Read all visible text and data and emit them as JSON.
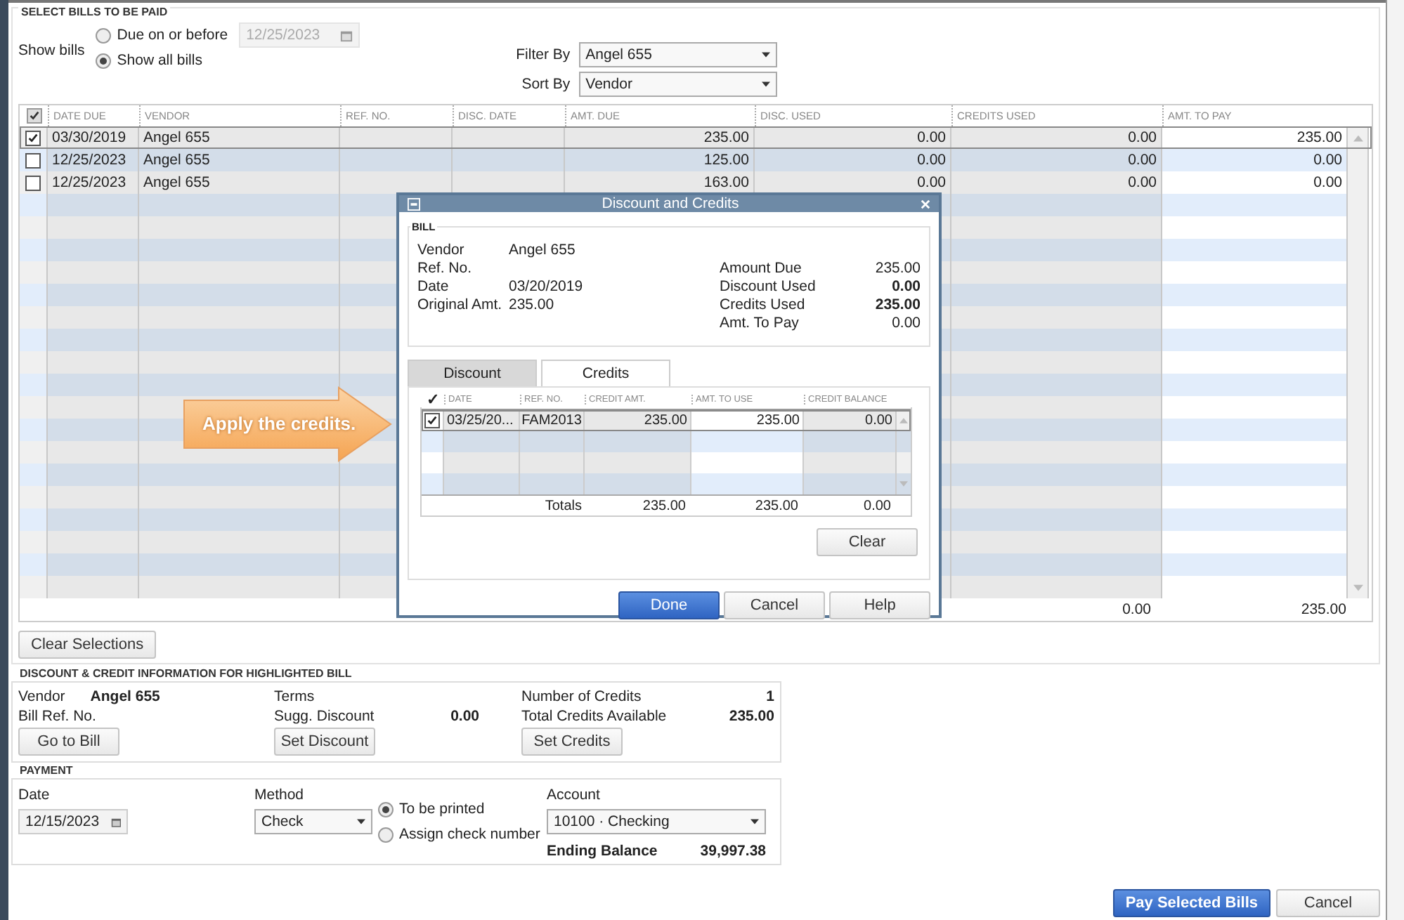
{
  "select_section": {
    "title": "SELECT BILLS TO BE PAID",
    "show_bills_label": "Show bills",
    "show_options": [
      {
        "label": "Due on or before",
        "selected": false
      },
      {
        "label": "Show all bills",
        "selected": true
      }
    ],
    "due_date": {
      "value": "12/25/2023",
      "disabled": true
    },
    "filter_by": {
      "label": "Filter By",
      "value": "Angel 655"
    },
    "sort_by": {
      "label": "Sort By",
      "value": "Vendor"
    }
  },
  "bills_table": {
    "select_all_checked": true,
    "columns": [
      "DATE DUE",
      "VENDOR",
      "REF. NO.",
      "DISC. DATE",
      "AMT. DUE",
      "DISC. USED",
      "CREDITS USED",
      "AMT. TO PAY"
    ],
    "rows": [
      {
        "checked": true,
        "selected": true,
        "date_due": "03/30/2019",
        "vendor": "Angel 655",
        "amt_due": "235.00",
        "disc_used": "0.00",
        "credits_used": "0.00",
        "amt_to_pay": "235.00"
      },
      {
        "checked": false,
        "selected": false,
        "date_due": "12/25/2023",
        "vendor": "Angel 655",
        "amt_due": "125.00",
        "disc_used": "0.00",
        "credits_used": "0.00",
        "amt_to_pay": "0.00"
      },
      {
        "checked": false,
        "selected": false,
        "date_due": "12/25/2023",
        "vendor": "Angel 655",
        "amt_due": "163.00",
        "disc_used": "0.00",
        "credits_used": "0.00",
        "amt_to_pay": "0.00"
      }
    ],
    "totals": {
      "credits_used": "0.00",
      "amt_to_pay": "235.00"
    }
  },
  "clear_selections": "Clear Selections",
  "discount_section": {
    "title": "DISCOUNT & CREDIT INFORMATION FOR HIGHLIGHTED BILL",
    "vendor_label": "Vendor",
    "vendor": "Angel 655",
    "bill_ref_label": "Bill Ref. No.",
    "terms_label": "Terms",
    "sugg_discount_label": "Sugg. Discount",
    "sugg_discount": "0.00",
    "num_credits_label": "Number of Credits",
    "num_credits": "1",
    "total_credits_label": "Total Credits Available",
    "total_credits": "235.00",
    "buttons": [
      "Go to Bill",
      "Set Discount",
      "Set Credits"
    ]
  },
  "payment": {
    "title": "PAYMENT",
    "date_label": "Date",
    "date": "12/15/2023",
    "method_label": "Method",
    "method": "Check",
    "print_options": [
      {
        "label": "To be printed",
        "selected": true
      },
      {
        "label": "Assign check number",
        "selected": false
      }
    ],
    "account_label": "Account",
    "account": "10100 · Checking",
    "ending_balance_label": "Ending Balance",
    "ending_balance": "39,997.38"
  },
  "footer_buttons": [
    {
      "label": "Pay Selected Bills",
      "kind": "primary"
    },
    {
      "label": "Cancel",
      "kind": "normal"
    }
  ],
  "callout": "Apply the credits.",
  "dialog": {
    "title": "Discount and Credits",
    "bill_title": "BILL",
    "left_fields": [
      {
        "label": "Vendor",
        "value": "Angel 655"
      },
      {
        "label": "Ref. No."
      },
      {
        "label": "Date",
        "value": "03/20/2019"
      },
      {
        "label": "Original Amt.",
        "value": "235.00"
      }
    ],
    "right_fields": [
      {
        "label": "Amount Due",
        "value": "235.00",
        "bold": false
      },
      {
        "label": "Discount Used",
        "value": "0.00",
        "bold": true
      },
      {
        "label": "Credits Used",
        "value": "235.00",
        "bold": true
      },
      {
        "label": "Amt. To Pay",
        "value": "0.00",
        "bold": false
      }
    ],
    "tabs": [
      {
        "label": "Discount",
        "selected": false
      },
      {
        "label": "Credits",
        "selected": true
      }
    ],
    "check_header": "✓",
    "columns": [
      "DATE",
      "REF. NO.",
      "CREDIT AMT.",
      "AMT. TO USE",
      "CREDIT BALANCE"
    ],
    "rows": [
      {
        "checked": true,
        "date": "03/25/20...",
        "ref_no": "FAM2013",
        "credit_amt": "235.00",
        "amt_to_use": "235.00",
        "credit_balance": "0.00"
      }
    ],
    "totals_label": "Totals",
    "totals": [
      "235.00",
      "235.00",
      "0.00"
    ],
    "buttons": [
      {
        "label": "Clear",
        "kind": "normal"
      },
      {
        "label": "Done",
        "kind": "primary"
      },
      {
        "label": "Cancel",
        "kind": "normal"
      },
      {
        "label": "Help",
        "kind": "normal"
      }
    ]
  }
}
